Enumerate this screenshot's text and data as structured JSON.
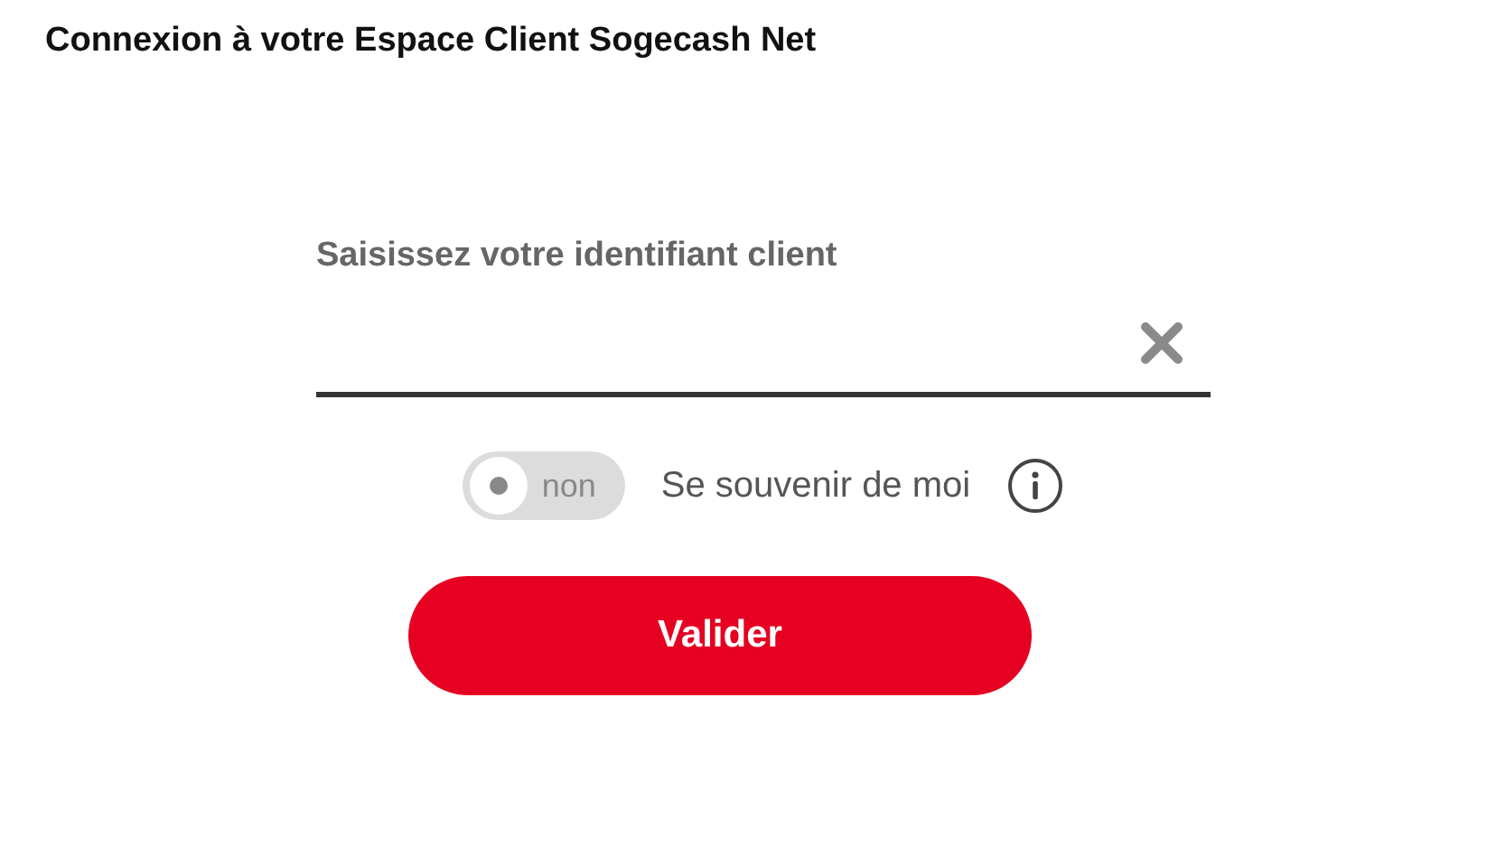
{
  "title": "Connexion à votre Espace Client Sogecash Net",
  "field": {
    "label": "Saisissez votre identifiant client"
  },
  "remember": {
    "on": false,
    "state_label": "non",
    "label": "Se souvenir de moi"
  },
  "submit": "Valider"
}
